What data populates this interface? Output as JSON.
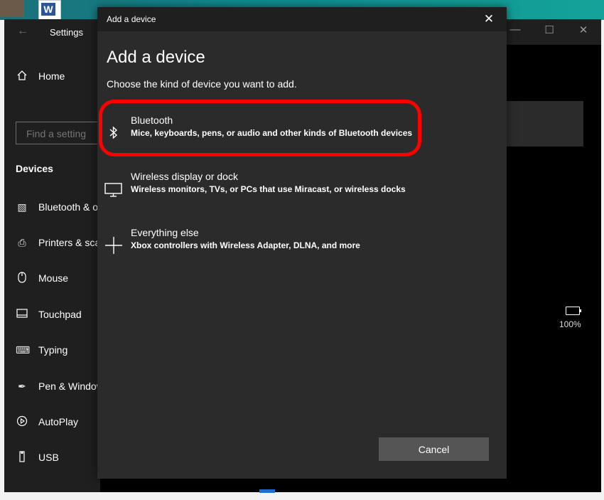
{
  "settings": {
    "title": "Settings",
    "home_label": "Home",
    "search_placeholder": "Find a setting",
    "section_heading": "Devices",
    "nav_items": [
      {
        "label": "Bluetooth & other devices",
        "icon": "bluetooth-devices-icon"
      },
      {
        "label": "Printers & scanners",
        "icon": "printer-icon"
      },
      {
        "label": "Mouse",
        "icon": "mouse-icon"
      },
      {
        "label": "Touchpad",
        "icon": "touchpad-icon"
      },
      {
        "label": "Typing",
        "icon": "keyboard-icon"
      },
      {
        "label": "Pen & Windows Ink",
        "icon": "pen-icon"
      },
      {
        "label": "AutoPlay",
        "icon": "autoplay-icon"
      },
      {
        "label": "USB",
        "icon": "usb-icon"
      }
    ],
    "battery": {
      "percent_label": "100%",
      "level": 1.0
    }
  },
  "dialog": {
    "window_title": "Add a device",
    "heading": "Add a device",
    "subtitle": "Choose the kind of device you want to add.",
    "options": [
      {
        "title": "Bluetooth",
        "description": "Mice, keyboards, pens, or audio and other kinds of Bluetooth devices",
        "icon": "bluetooth-icon",
        "highlighted": true
      },
      {
        "title": "Wireless display or dock",
        "description": "Wireless monitors, TVs, or PCs that use Miracast, or wireless docks",
        "icon": "monitor-icon"
      },
      {
        "title": "Everything else",
        "description": "Xbox controllers with Wireless Adapter, DLNA, and more",
        "icon": "plus-icon"
      }
    ],
    "cancel_label": "Cancel"
  },
  "colors": {
    "highlight": "#ff0000",
    "dialog_bg": "#2b2b2b",
    "titlebar_bg": "#1f1f1f",
    "cancel_bg": "#555555"
  }
}
